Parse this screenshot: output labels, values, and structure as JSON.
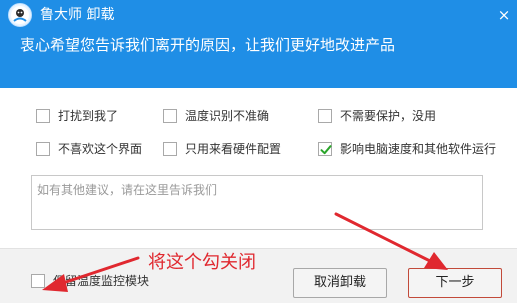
{
  "header": {
    "app_title": "鲁大师 卸载",
    "subtitle": "衷心希望您告诉我们离开的原因，让我们更好地改进产品",
    "close_glyph": "×"
  },
  "reasons": [
    {
      "label": "打扰到我了",
      "checked": false
    },
    {
      "label": "温度识别不准确",
      "checked": false
    },
    {
      "label": "不需要保护，没用",
      "checked": false
    },
    {
      "label": "不喜欢这个界面",
      "checked": false
    },
    {
      "label": "只用来看硬件配置",
      "checked": false
    },
    {
      "label": "影响电脑速度和其他软件运行",
      "checked": true
    }
  ],
  "feedback": {
    "placeholder": "如有其他建议，请在这里告诉我们",
    "value": ""
  },
  "footer": {
    "keep_module_label": "保留温度监控模块",
    "keep_module_checked": false,
    "cancel_label": "取消卸载",
    "next_label": "下一步"
  },
  "annotation": {
    "text": "将这个勾关闭",
    "color": "#e0282f"
  },
  "colors": {
    "header_bg": "#1f8ee6",
    "check_green": "#2aa52a",
    "annotation_red": "#e0282f"
  },
  "icons": {
    "logo": "ludashi-logo-icon",
    "close": "close-icon",
    "check": "checkmark-icon"
  }
}
